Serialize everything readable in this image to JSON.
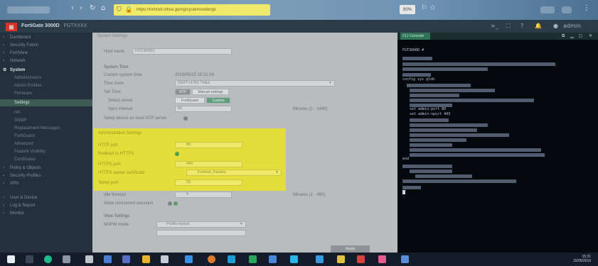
{
  "browser": {
    "url": "https://fortinet.office.ge/ng/system/settings",
    "zoom": "80%",
    "lock_icon": "lock-icon",
    "tracking_icon": "shield-icon"
  },
  "app": {
    "title": "FortiGate 3000D",
    "subtitle": "FGTXXXX"
  },
  "sidebar": {
    "items": [
      {
        "label": "Dashboard",
        "type": "bold-dim"
      },
      {
        "label": "Security Fabric",
        "type": "normal"
      },
      {
        "label": "FortiView",
        "type": "normal"
      },
      {
        "label": "Network",
        "type": "normal"
      },
      {
        "label": "System",
        "type": "bold"
      },
      {
        "label": "Administrators",
        "type": "sub"
      },
      {
        "label": "Admin Profiles",
        "type": "sub"
      },
      {
        "label": "Firmware",
        "type": "sub"
      },
      {
        "label": "Settings",
        "type": "active"
      },
      {
        "label": "HA",
        "type": "sub"
      },
      {
        "label": "SNMP",
        "type": "sub"
      },
      {
        "label": "Replacement Messages",
        "type": "sub"
      },
      {
        "label": "FortiGuard",
        "type": "sub"
      },
      {
        "label": "Advanced",
        "type": "sub"
      },
      {
        "label": "Feature Visibility",
        "type": "sub"
      },
      {
        "label": "Certificates",
        "type": "sub"
      },
      {
        "label": "Policy & Objects",
        "type": "normal"
      },
      {
        "label": "Security Profiles",
        "type": "normal"
      },
      {
        "label": "VPN",
        "type": "normal"
      },
      {
        "label": "User & Device",
        "type": "normal"
      },
      {
        "label": "Log & Report",
        "type": "normal"
      },
      {
        "label": "Monitor",
        "type": "normal"
      }
    ]
  },
  "main": {
    "tab": "System Settings",
    "host_label": "Host name",
    "host_value": "FGT3000D",
    "system_time": "System Time",
    "current_time_label": "Current system time",
    "current_time_value": "2019/05/15 15:31:04",
    "time_zone_label": "Time zone",
    "time_zone_value": "(GMT+4:00) Tbilisi",
    "set_time_label": "Set Time",
    "set_time_options": [
      "NTP",
      "Manual settings"
    ],
    "select_server_label": "Select server",
    "select_server_options": [
      "FortiGuard",
      "Custom"
    ],
    "sync_interval_label": "Sync interval",
    "sync_interval_value": "60",
    "sync_interval_unit": "Minutes (1 - 1440)",
    "setup_device_label": "Setup device as local NTP server",
    "admin_section": "Administration Settings",
    "http_port_label": "HTTP port",
    "http_port_value": "80",
    "redirect_label": "Redirect to HTTPS",
    "https_port_label": "HTTPS port",
    "https_port_value": "443",
    "https_cert_label": "HTTPS server certificate",
    "https_cert_value": "Fortinet_Factory",
    "telnet_port_label": "Telnet port",
    "telnet_port_value": "23",
    "idle_timeout_label": "Idle timeout",
    "idle_timeout_value": "5",
    "idle_timeout_unit": "Minutes (1 - 480)",
    "concurrent_label": "Allow concurrent sessions",
    "view_section": "View Settings",
    "nat_label": "NGFW mode",
    "nat_value": "Profile-based",
    "apply_label": "Apply"
  },
  "terminal": {
    "tab": "CLI Console",
    "lines": [
      "FGT3000D #",
      "config sys glob",
      "set admin-port 80",
      "set admin-sport 443",
      "end"
    ]
  },
  "taskbar": {
    "time": "15:31",
    "date": "15/05/2019"
  }
}
